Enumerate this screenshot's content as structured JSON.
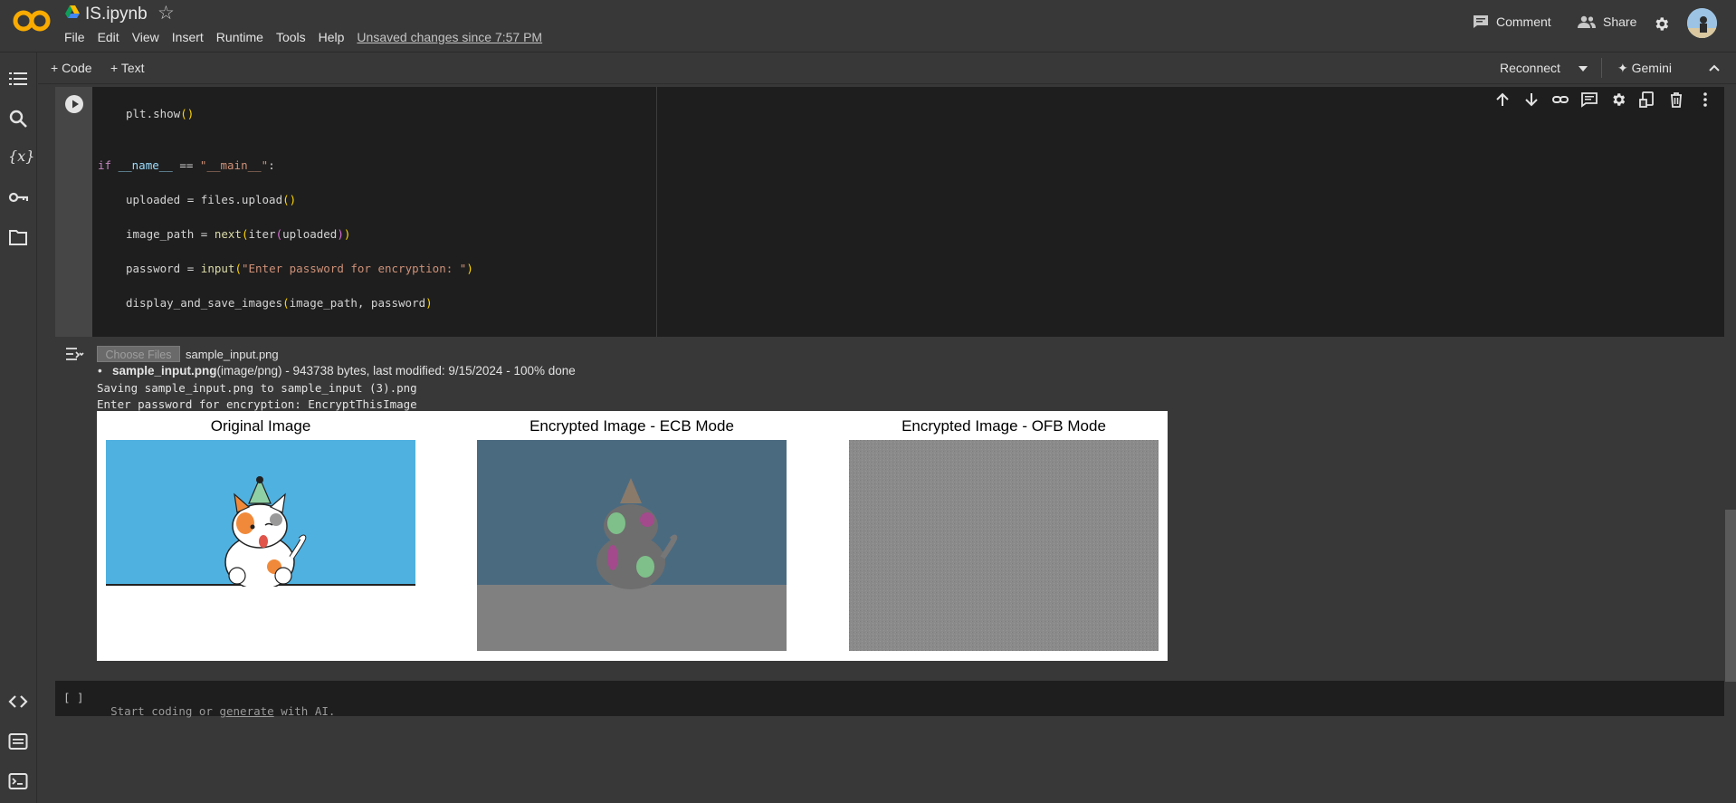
{
  "header": {
    "title": "IS.ipynb",
    "menu": [
      "File",
      "Edit",
      "View",
      "Insert",
      "Runtime",
      "Tools",
      "Help"
    ],
    "unsaved": "Unsaved changes since 7:57 PM",
    "comment_label": "Comment",
    "share_label": "Share"
  },
  "toolbar": {
    "add_code": "+ Code",
    "add_text": "+ Text",
    "reconnect": "Reconnect",
    "gemini": "Gemini"
  },
  "cell1": {
    "lines": [
      {
        "id": "l1",
        "text": "plt.show()"
      },
      {
        "id": "l2",
        "text": "if __name__ == \"__main__\":"
      },
      {
        "id": "l3",
        "text": "uploaded = files.upload()"
      },
      {
        "id": "l4",
        "text": "image_path = next(iter(uploaded))"
      },
      {
        "id": "l5",
        "text": "password = input(\"Enter password for encryption: \")"
      },
      {
        "id": "l6",
        "text": "display_and_save_images(image_path, password)"
      }
    ]
  },
  "output": {
    "choose_files": "Choose Files",
    "chosen_file": "sample_input.png",
    "file_bold": "sample_input.png",
    "file_info": "(image/png) - 943738 bytes, last modified: 9/15/2024 - 100% done",
    "saving": "Saving sample_input.png to sample_input (3).png",
    "password_prompt": "Enter password for encryption: EncryptThisImage",
    "figure_titles": [
      "Original Image",
      "Encrypted Image - ECB Mode",
      "Encrypted Image - OFB Mode"
    ]
  },
  "cell2": {
    "brackets": "[ ]",
    "placeholder_pre": "Start coding or ",
    "placeholder_link": "generate",
    "placeholder_post": " with AI."
  },
  "colors": {
    "background": "#383838",
    "code_bg": "#1e1e1e",
    "logo": "#f9ab00",
    "original_sky": "#4fb1e0",
    "ecb_blue": "#4a6a80",
    "ecb_gray": "#808080",
    "ofb_gray": "#8a8a8a"
  }
}
